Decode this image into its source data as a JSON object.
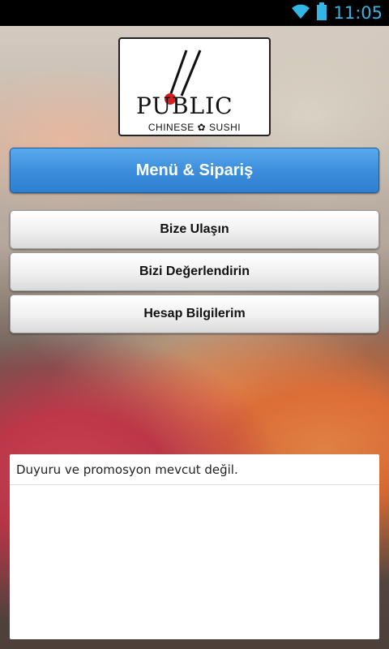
{
  "status_bar": {
    "time": "11:05",
    "wifi_icon": "wifi-icon",
    "battery_icon": "battery-icon"
  },
  "logo": {
    "word": "PUBLIC",
    "subtitle": "CHINESE ✿ SUSHI",
    "accent_color": "#d22020"
  },
  "buttons": {
    "primary_label": "Menü & Sipariş",
    "contact_label": "Bize Ulaşın",
    "rate_label": "Bizi Değerlendirin",
    "account_label": "Hesap Bilgilerim"
  },
  "announcements": {
    "message": "Duyuru ve promosyon mevcut değil."
  },
  "colors": {
    "primary": "#3d8fdd",
    "status_accent": "#33b5e5"
  }
}
